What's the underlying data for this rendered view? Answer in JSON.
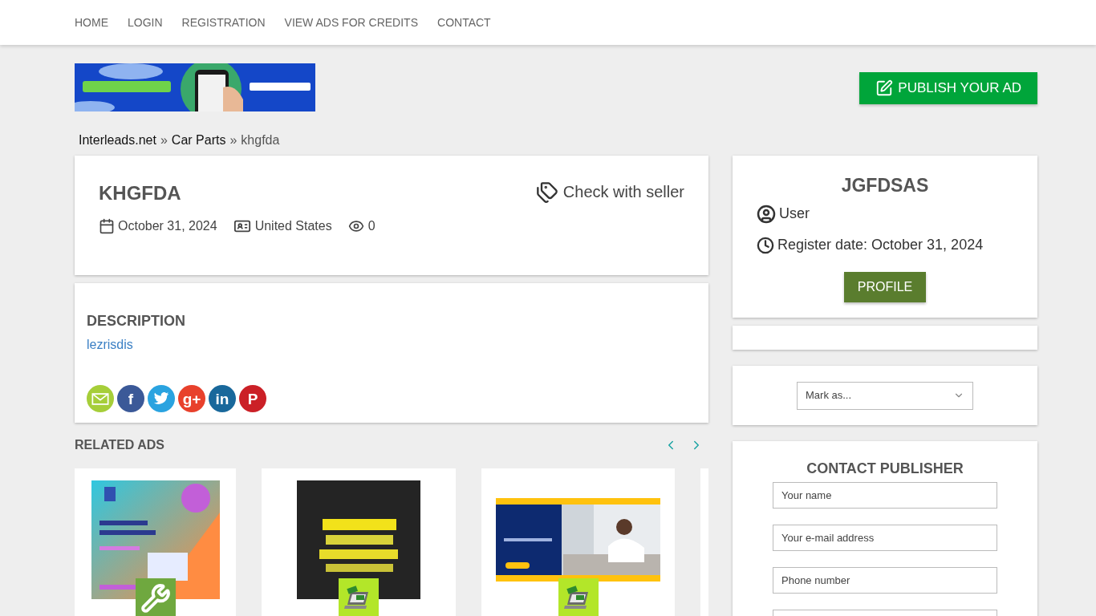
{
  "nav": [
    {
      "label": "HOME"
    },
    {
      "label": "LOGIN"
    },
    {
      "label": "REGISTRATION"
    },
    {
      "label": "VIEW ADS FOR CREDITS"
    },
    {
      "label": "CONTACT"
    }
  ],
  "publish_button": "PUBLISH YOUR AD",
  "breadcrumb": [
    {
      "label": "Interleads.net"
    },
    {
      "label": "Car Parts"
    },
    {
      "label": "khgfda"
    }
  ],
  "breadcrumb_separator": "»",
  "ad": {
    "title": "KHGFDA",
    "price": "Check with seller",
    "date": "October 31, 2024",
    "location": "United States",
    "views": "0"
  },
  "description": {
    "heading": "DESCRIPTION",
    "text": "lezrisdis"
  },
  "share_icons": [
    {
      "kind": "email",
      "color": "#a6ce39"
    },
    {
      "kind": "glyph",
      "glyph": "f",
      "color": "#3b5998"
    },
    {
      "kind": "bird",
      "color": "#2aa3e0"
    },
    {
      "kind": "glyph",
      "glyph": "g+",
      "color": "#e8412c"
    },
    {
      "kind": "glyph",
      "glyph": "in",
      "color": "#19689b"
    },
    {
      "kind": "glyph",
      "glyph": "P",
      "color": "#cb2027"
    }
  ],
  "related": {
    "heading": "RELATED ADS",
    "cards": [
      {
        "kind": "tools",
        "color": "#6fa83f"
      },
      {
        "kind": "laptop-money",
        "color": "#b3e629"
      },
      {
        "kind": "laptop-money",
        "color": "#b3e629"
      }
    ]
  },
  "seller": {
    "name": "JGFDSAS",
    "role": "User",
    "register_date": "Register date: October 31, 2024",
    "profile_button": "PROFILE"
  },
  "mark_select": {
    "placeholder": "Mark as..."
  },
  "contact": {
    "heading": "CONTACT PUBLISHER",
    "fields": [
      {
        "placeholder": "Your name"
      },
      {
        "placeholder": "Your e-mail address"
      },
      {
        "placeholder": "Phone number"
      }
    ]
  }
}
